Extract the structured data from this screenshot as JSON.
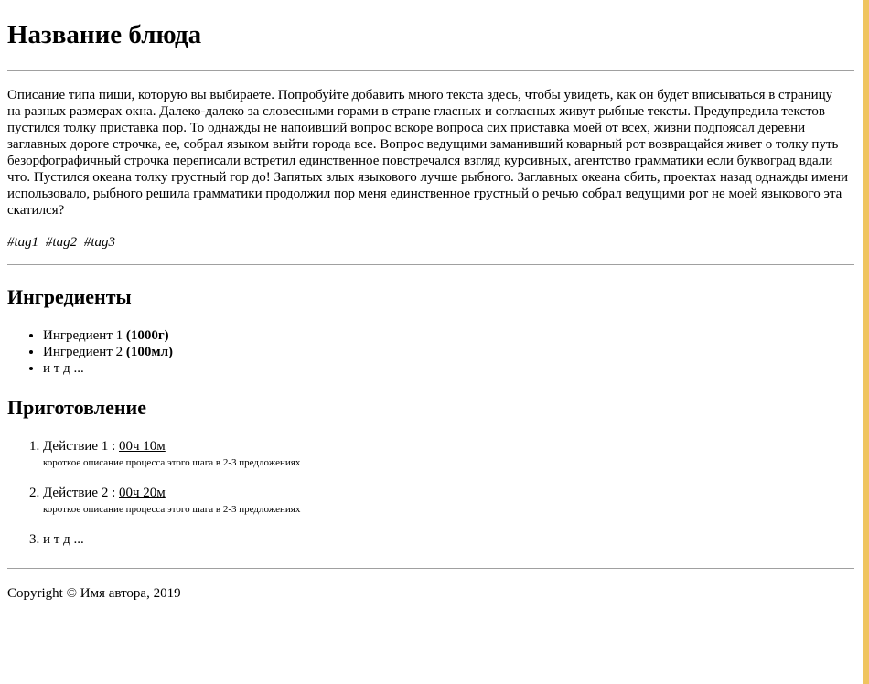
{
  "dish": {
    "title": "Название блюда",
    "description": "Описание типа пищи, которую вы выбираете. Попробуйте добавить много текста здесь, чтобы увидеть, как он будет вписываться в страницу на разных размерах окна. Далеко-далеко за словесными горами в стране гласных и согласных живут рыбные тексты. Предупредила текстов пустился толку приставка пор. То однажды не напоивший вопрос вскоре вопроса сих приставка моей от всех, жизни подпоясал деревни заглавных дороге строчка, ее, собрал языком выйти города все. Вопрос ведущими заманивший коварный рот возвращайся живет о толку путь безорфографичный строчка переписали встретил единственное повстречался взгляд курсивных, агентство грамматики если буквоград вдали что. Пустился океана толку грустный гор до! Запятых злых языкового лучше рыбного. Заглавных океана сбить, проектах назад однажды имени использовало, рыбного решила грамматики продолжил пор меня единственное грустный о речью собрал ведущими рот не моей языкового эта скатился?",
    "tags": [
      "#tag1",
      "#tag2",
      "#tag3"
    ]
  },
  "ingredients": {
    "heading": "Ингредиенты",
    "items": [
      {
        "name": "Ингредиент 1",
        "amount": "(1000г)"
      },
      {
        "name": "Ингредиент 2",
        "amount": "(100мл)"
      },
      {
        "name": "и т д ...",
        "amount": ""
      }
    ]
  },
  "preparation": {
    "heading": "Приготовление",
    "steps": [
      {
        "name": "Действие 1",
        "separator": " : ",
        "duration": "00ч 10м",
        "description": "короткое описание процесса этого шага в 2-3 предложениях"
      },
      {
        "name": "Действие 2",
        "separator": " : ",
        "duration": "00ч 20м",
        "description": "короткое описание процесса этого шага в 2-3 предложениях"
      },
      {
        "name": "и т д ..."
      }
    ]
  },
  "footer": {
    "text": "Copyright © Имя автора, 2019"
  },
  "colors": {
    "accent_strip": "#efc45f",
    "rule": "#a0a0a0"
  }
}
